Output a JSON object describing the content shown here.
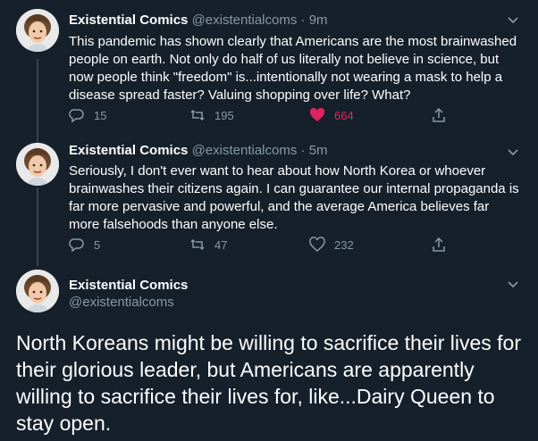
{
  "tweets": [
    {
      "name": "Existential Comics",
      "handle": "@existentialcoms",
      "sep": "·",
      "time": "9m",
      "text": "This pandemic has shown clearly that Americans are the most brainwashed people on earth. Not only do half of us literally not believe in science, but now people think \"freedom\" is...intentionally not wearing a mask to help a disease spread faster? Valuing shopping over life? What?",
      "replies": "15",
      "retweets": "195",
      "likes": "664",
      "liked": true
    },
    {
      "name": "Existential Comics",
      "handle": "@existentialcoms",
      "sep": "·",
      "time": "5m",
      "text": "Seriously, I don't ever want to hear about how North Korea or whoever brainwashes their citizens again. I can guarantee our internal propaganda is far more pervasive and powerful, and the average America believes far more falsehoods than anyone else.",
      "replies": "5",
      "retweets": "47",
      "likes": "232",
      "liked": false
    }
  ],
  "main": {
    "name": "Existential Comics",
    "handle": "@existentialcoms",
    "text": "North Koreans might be willing to sacrifice their lives for their glorious leader, but Americans are apparently willing to sacrifice their lives for, like...Dairy Queen to stay open."
  },
  "colors": {
    "background": "#15202b",
    "muted": "#8899a6",
    "like": "#e0245e"
  },
  "icons": [
    "reply-icon",
    "retweet-icon",
    "heart-icon",
    "share-icon",
    "chevron-down-icon"
  ]
}
